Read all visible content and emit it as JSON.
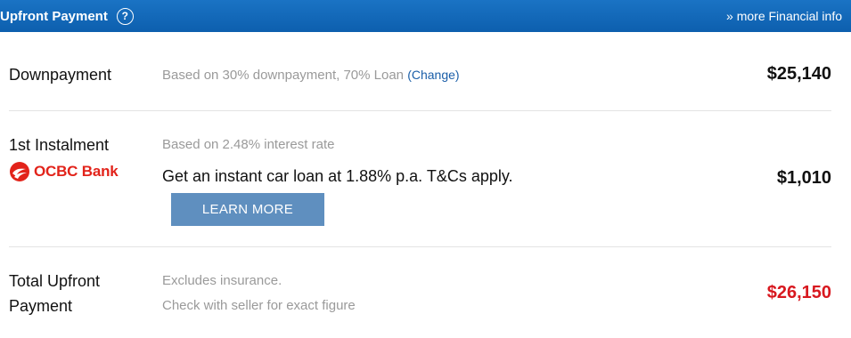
{
  "header": {
    "title": "Upfront Payment",
    "help_icon": "?",
    "more_link": "» more Financial info"
  },
  "downpayment": {
    "label": "Downpayment",
    "desc": "Based on 30% downpayment, 70% Loan",
    "change_open": "(",
    "change_label": "Change",
    "change_close": ")",
    "value": "$25,140"
  },
  "instalment": {
    "label": "1st Instalment",
    "desc": "Based on 2.48% interest rate",
    "bank_logo_text": "OCBC Bank",
    "promo": "Get an instant car loan at 1.88% p.a. T&Cs apply.",
    "button_label": "LEARN MORE",
    "value": "$1,010"
  },
  "total": {
    "label_line1": "Total Upfront",
    "label_line2": "Payment",
    "desc_line1": "Excludes insurance.",
    "desc_line2": "Check with seller for exact figure",
    "value": "$26,150",
    "value_color": "#d8181f"
  },
  "colors": {
    "header_bg": "#1a73c4",
    "button_bg": "#5f8fbf",
    "ocbc_red": "#e2231a"
  }
}
